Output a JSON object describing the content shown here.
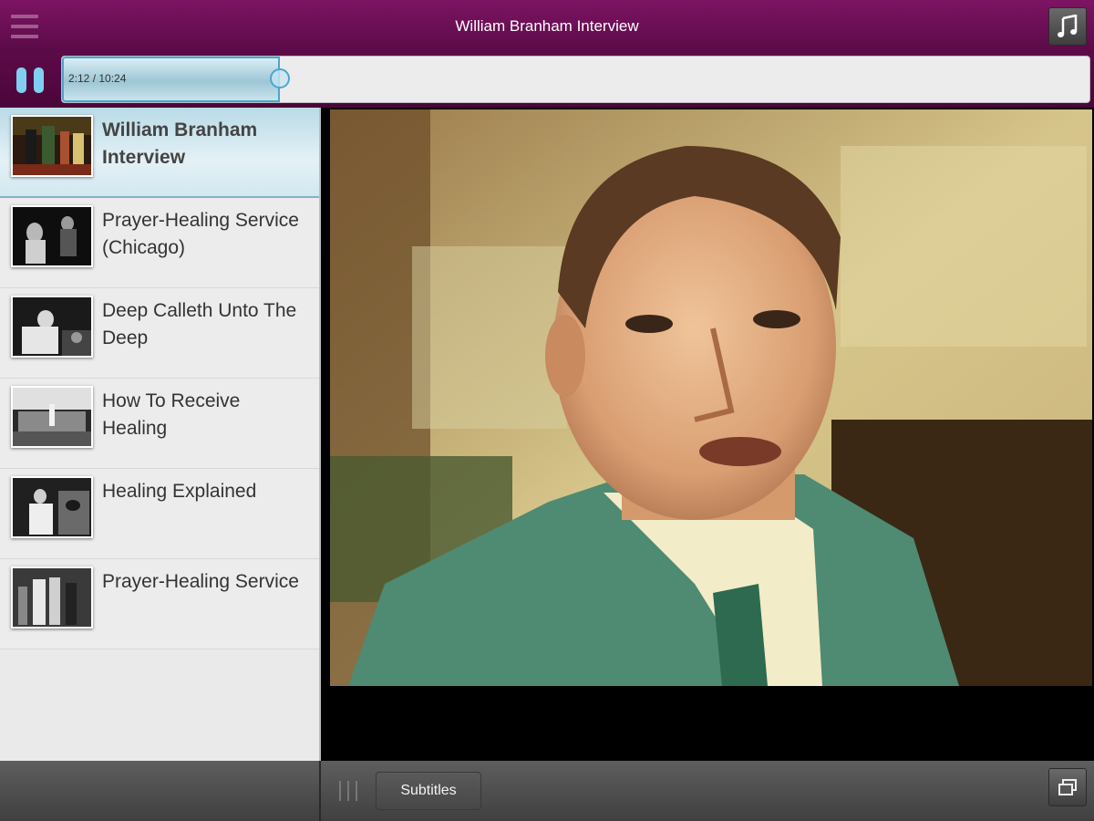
{
  "header": {
    "title": "William Branham Interview",
    "menu_icon": "hamburger-menu-icon",
    "audio_icon": "music-note-icon"
  },
  "player": {
    "time_display": "2:12 / 10:24",
    "progress_fraction": 0.212,
    "pause_icon": "pause-icon",
    "accent_color": "#4aa6cf"
  },
  "playlist": {
    "items": [
      {
        "title": "William Branham Interview",
        "selected": true
      },
      {
        "title": "Prayer-Healing Service (Chicago)",
        "selected": false
      },
      {
        "title": "Deep Calleth Unto The Deep",
        "selected": false
      },
      {
        "title": "How To Receive Healing",
        "selected": false
      },
      {
        "title": "Healing Explained",
        "selected": false
      },
      {
        "title": "Prayer-Healing Service",
        "selected": false
      }
    ]
  },
  "toolbar": {
    "subtitles_label": "Subtitles",
    "fullscreen_icon": "fullscreen-icon",
    "grip_icon": "drag-handle-icon"
  },
  "colors": {
    "header_bg": "#7d1463",
    "selected_row": "#b9dbe7"
  }
}
